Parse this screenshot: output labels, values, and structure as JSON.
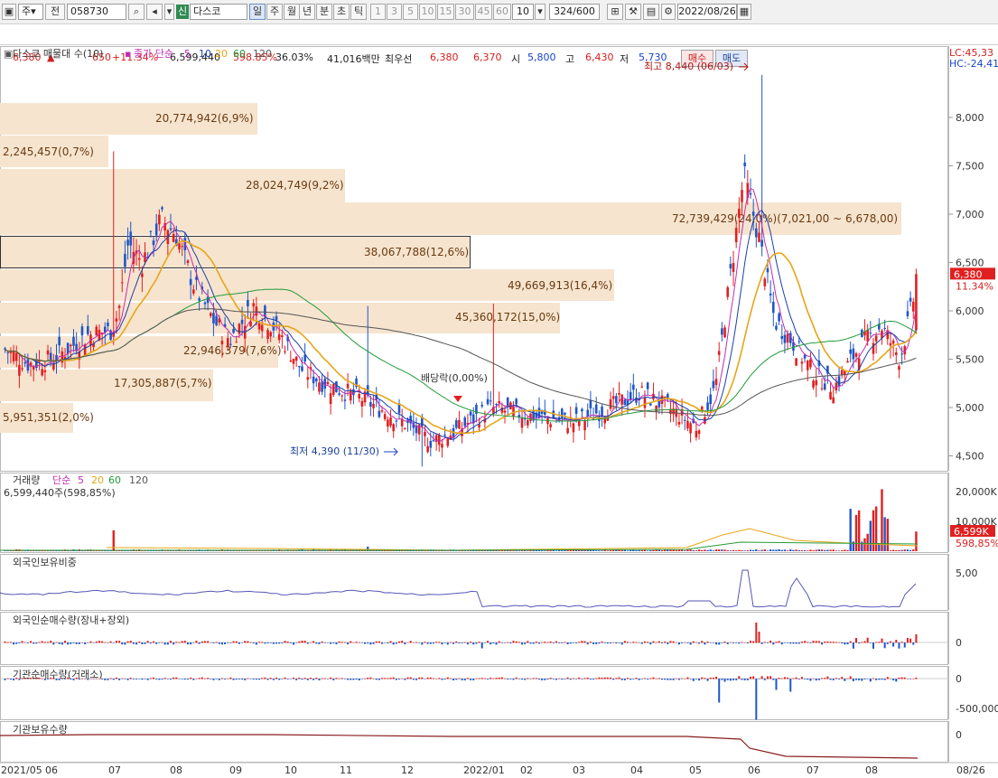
{
  "toolbar": {
    "type_sel": "주",
    "prev_label": "전",
    "code": "058730",
    "market_tag": "신",
    "stock_name": "다스코",
    "periods": [
      "일",
      "주",
      "월",
      "년",
      "분",
      "초",
      "틱"
    ],
    "intervals": [
      "1",
      "3",
      "5",
      "10",
      "15",
      "30",
      "45",
      "60"
    ],
    "interval_value": "10",
    "count": "324",
    "count_total": "/600",
    "date": "2022/08/26"
  },
  "quote": {
    "price": "6,380",
    "arrow": "▲",
    "change": "650",
    "change_pct": "+11.34%",
    "volume": "6,599,440",
    "vol_ratio": "598.85%",
    "turnover": "36.03%",
    "amount": "41,016백만",
    "ask_label": "최우선",
    "ask": "6,380",
    "bid": "6,370",
    "open_label": "시",
    "open": "5,800",
    "high_label": "고",
    "high": "6,430",
    "low_label": "저",
    "low": "5,730",
    "buy_label": "매수",
    "sell_label": "매도"
  },
  "price_panel": {
    "legend_main": "다스코 매물대 수(10)",
    "ma_label": "종가 단순",
    "ma_periods": [
      "5",
      "10",
      "20",
      "60",
      "120"
    ],
    "lc": "LC:45,33",
    "hc": "HC:-24,41",
    "high_note": "최고 8,440 (06/03)",
    "low_note": "최저 4,390 (11/30)",
    "dividend_note": "배당락(0,00%)",
    "current_price": "6,380",
    "current_pct": "11.34%",
    "price_ticks": [
      "8,000",
      "7,500",
      "7,000",
      "6,500",
      "6,000",
      "5,500",
      "5,000",
      "4,500"
    ],
    "volume_profile": [
      {
        "label": "20,774,942(6,9%)"
      },
      {
        "label": "2,245,457(0,7%)"
      },
      {
        "label": "28,024,749(9,2%)"
      },
      {
        "label": "72,739,429(24,0%)(7,021,00 ~ 6,678,00)"
      },
      {
        "label": "38,067,788(12,6%)"
      },
      {
        "label": "49,669,913(16,4%)"
      },
      {
        "label": "45,360,172(15,0%)"
      },
      {
        "label": "22,946,379(7,6%)"
      },
      {
        "label": "17,305,887(5,7%)"
      },
      {
        "label": "5,951,351(2,0%)"
      }
    ]
  },
  "volume_panel": {
    "title": "거래량",
    "ma_label": "단순",
    "ma_periods": [
      "5",
      "20",
      "60",
      "120"
    ],
    "value": "6,599,440주(598,85%)",
    "ticks": [
      "20,000K",
      "10,000K"
    ],
    "current": "6,599K",
    "current_pct": "598,85%"
  },
  "foreign_panel": {
    "title": "외국인보유비중",
    "tick": "5,00"
  },
  "foreign_net_panel": {
    "title": "외국인순매수량(장내+장외)",
    "tick": "0"
  },
  "inst_net_panel": {
    "title": "기관순매수량(거래소)",
    "ticks": [
      "0",
      "-500,000"
    ]
  },
  "inst_hold_panel": {
    "title": "기관보유수량",
    "tick": "0"
  },
  "xaxis": [
    "2021/05",
    "06",
    "07",
    "08",
    "09",
    "10",
    "11",
    "12",
    "2022/01",
    "02",
    "03",
    "04",
    "05",
    "06",
    "07",
    "08",
    "08/26"
  ],
  "colors": {
    "up": "#e02020",
    "down": "#1f56c8",
    "ma5": "#c02fb0",
    "ma10": "#1b3fa8",
    "ma20": "#e6a617",
    "ma60": "#239b3a",
    "ma120": "#555555",
    "profile": "#f6e4cf"
  }
}
